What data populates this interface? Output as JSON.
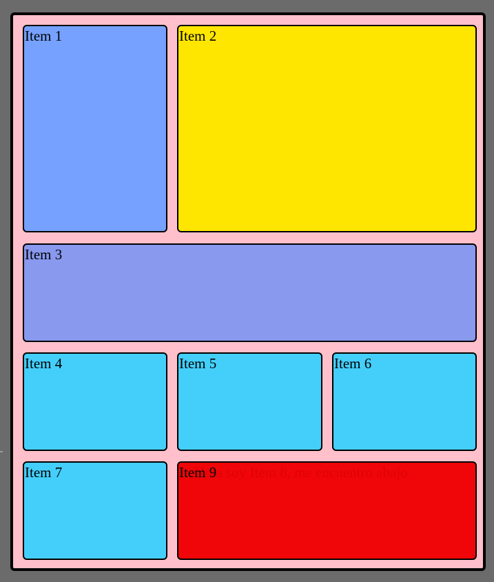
{
  "colors": {
    "page_background": "#6b6b6b",
    "container_background": "#ffc0cb",
    "item1": "#76a1ff",
    "item2": "#ffe600",
    "item3": "#8899ee",
    "items_4_to_7": "#44cffb",
    "item9": "#f00509"
  },
  "items": {
    "item1": "Item 1",
    "item2": "Item 2",
    "item3": "Item 3",
    "item4": "Item 4",
    "item5": "Item 5",
    "item6": "Item 6",
    "item7": "Item 7",
    "item9": "Item 9",
    "hidden_item8_text": "Hola soy Item 8, me encuentro abajo"
  }
}
